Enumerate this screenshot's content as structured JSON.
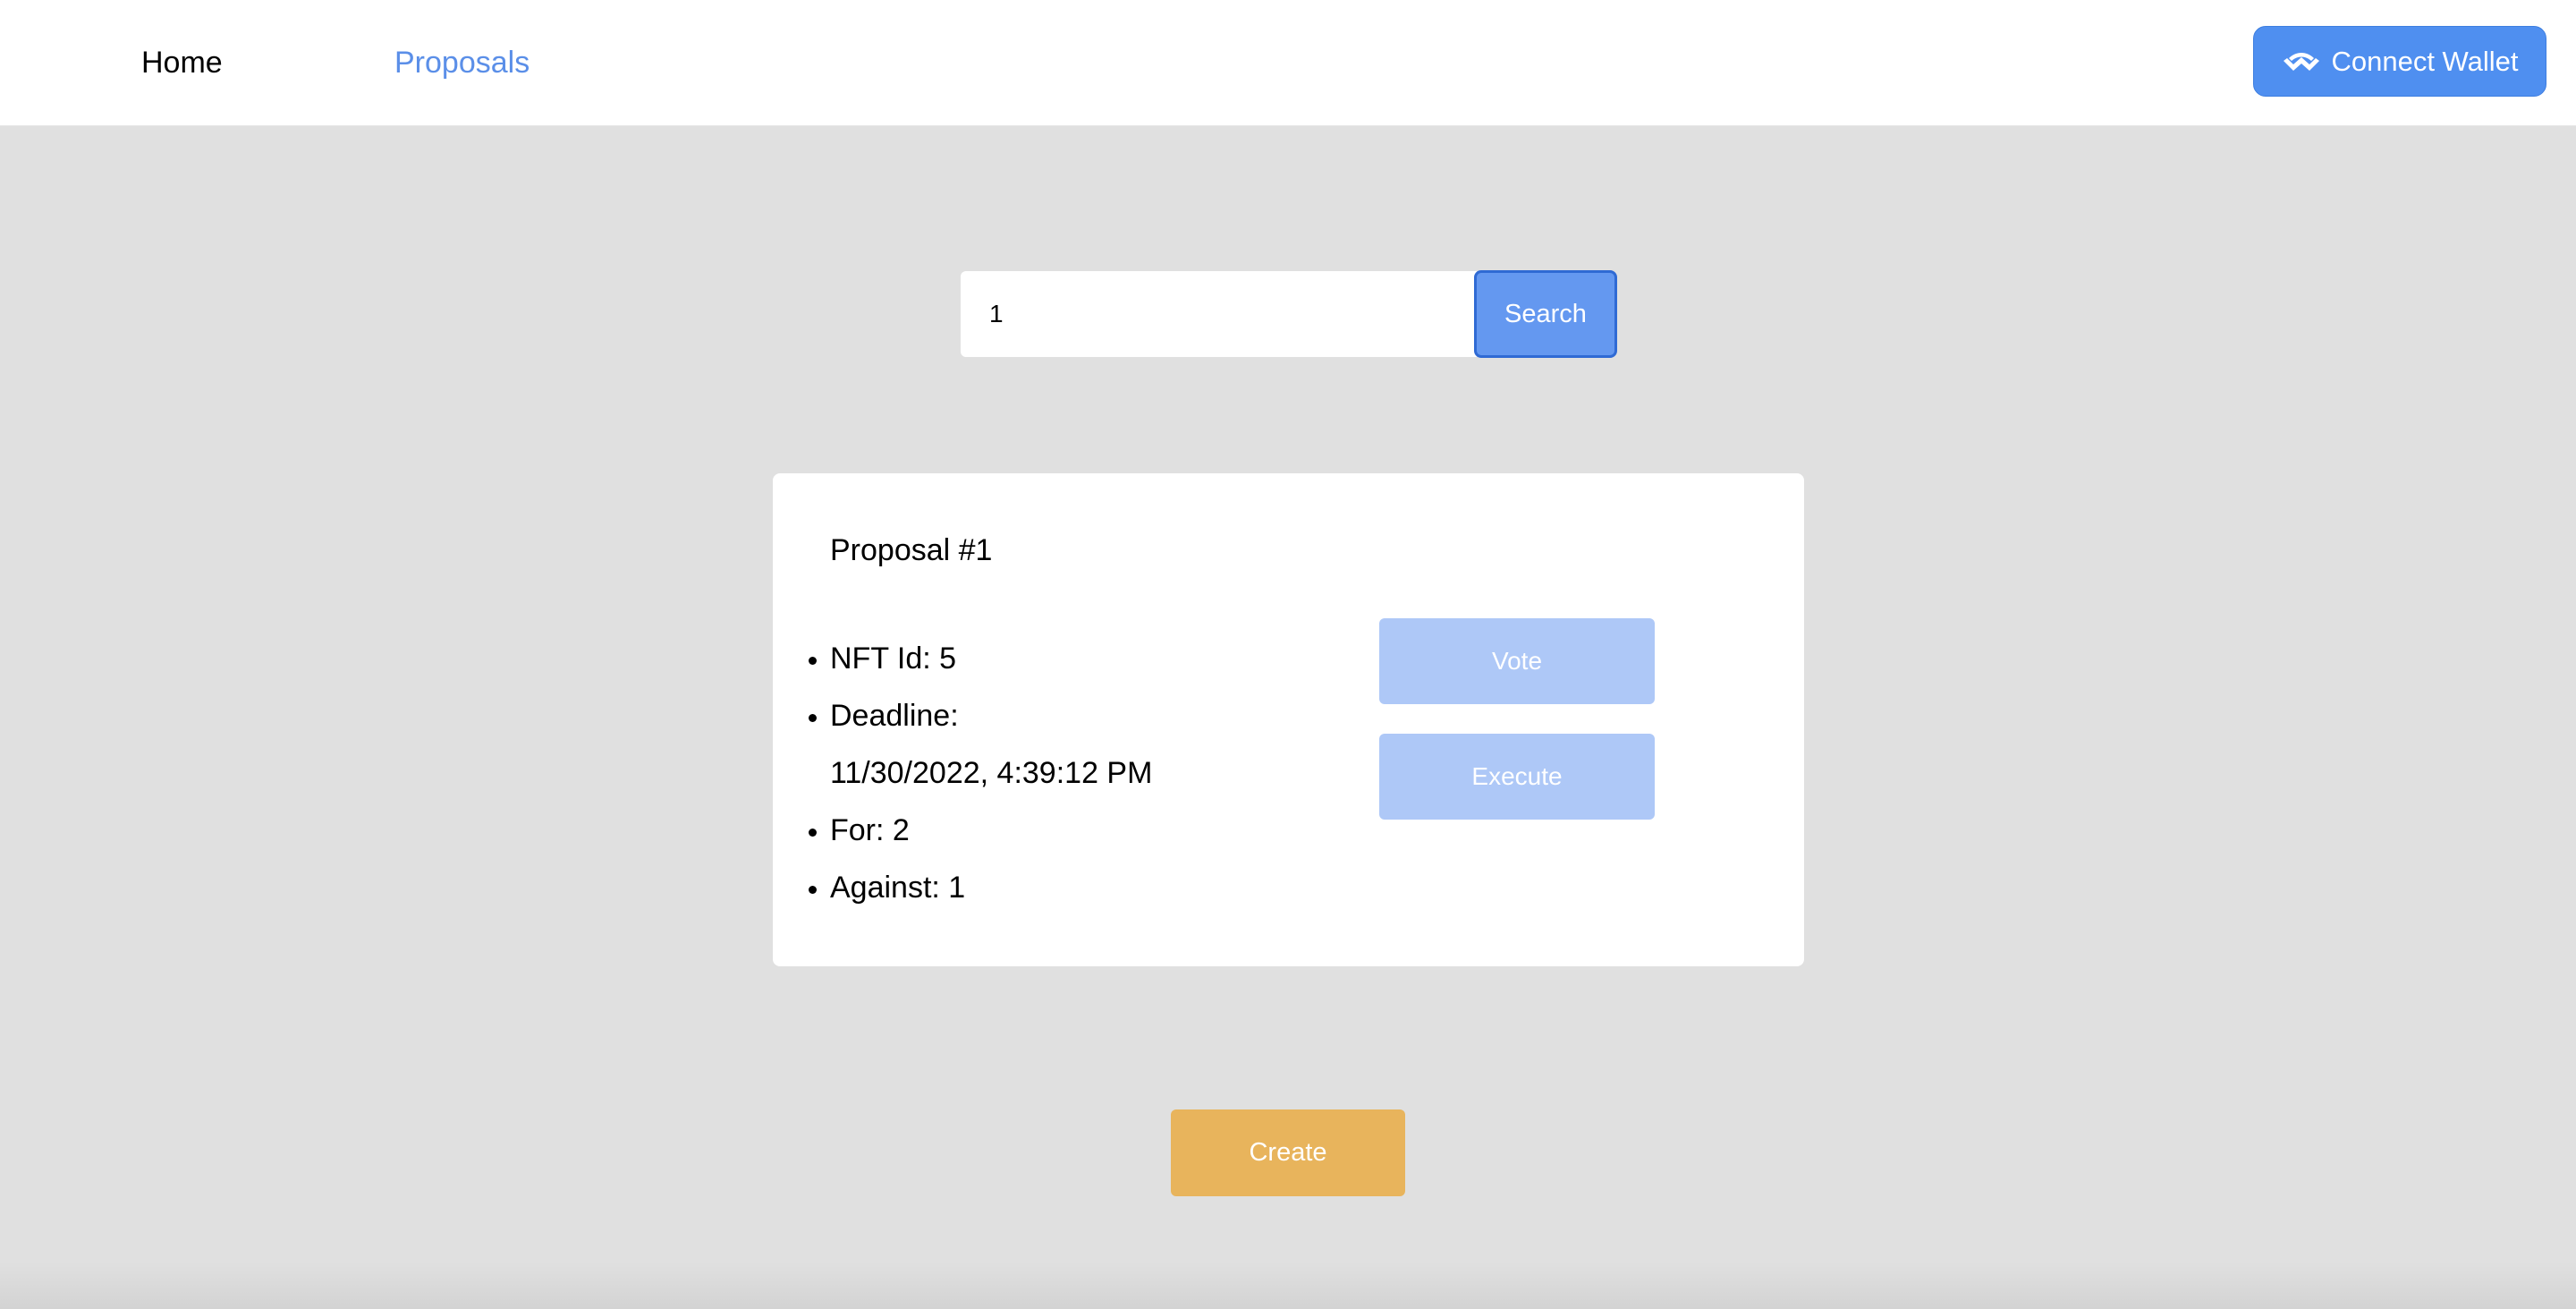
{
  "nav": {
    "home_label": "Home",
    "proposals_label": "Proposals",
    "connect_wallet_label": "Connect Wallet"
  },
  "search": {
    "value": "1",
    "button_label": "Search"
  },
  "proposal": {
    "title": "Proposal #1",
    "details": {
      "nft_id": "NFT Id: 5",
      "deadline_label": "Deadline:",
      "deadline_value": "11/30/2022, 4:39:12 PM",
      "for": "For: 2",
      "against": "Against: 1"
    },
    "vote_label": "Vote",
    "execute_label": "Execute"
  },
  "create_label": "Create",
  "colors": {
    "accent": "#4f8ff0",
    "nav_active": "#5b8fe8",
    "disabled_button": "#aec8f7",
    "create_button": "#e8b45c",
    "background": "#e0e0e0"
  },
  "icons": {
    "wallet": "walletconnect-icon"
  }
}
